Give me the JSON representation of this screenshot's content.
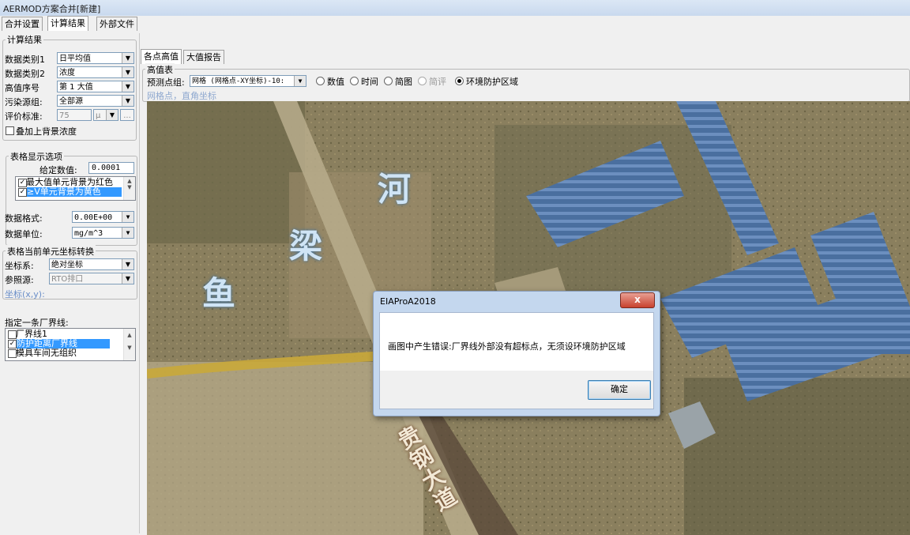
{
  "window": {
    "title": "AERMOD方案合并[新建]"
  },
  "main_tabs": [
    {
      "label": "合并设置"
    },
    {
      "label": "计算结果"
    },
    {
      "label": "外部文件"
    }
  ],
  "calc_results": {
    "group_title": "计算结果",
    "fields": [
      {
        "label": "数据类别1",
        "value": "日平均值"
      },
      {
        "label": "数据类别2",
        "value": "浓度"
      },
      {
        "label": "高值序号",
        "value": "第 1 大值"
      },
      {
        "label": "污染源组:",
        "value": "全部源"
      }
    ],
    "eval_standard": {
      "label": "评价标准:",
      "value": "75",
      "unit": "μ",
      "more": "..."
    },
    "overlay_background": {
      "label": "叠加上背景浓度",
      "checked": false
    }
  },
  "table_display": {
    "group_title": "表格显示选项",
    "given_value_label": "给定数值:",
    "given_value": "0.0001",
    "options": [
      {
        "label": "最大值单元背景为红色",
        "checked": true,
        "selected": false
      },
      {
        "label": "≥V单元背景为黄色",
        "checked": true,
        "selected": true
      }
    ],
    "data_format_label": "数据格式:",
    "data_format": "0.00E+00",
    "data_unit_label": "数据单位:",
    "data_unit": "mg/m^3"
  },
  "coord_convert": {
    "group_title": "表格当前单元坐标转换",
    "coord_system_label": "坐标系:",
    "coord_system": "绝对坐标",
    "reference_label": "参照源:",
    "reference": "RTO排口",
    "coord_readout": "坐标(x,y):"
  },
  "boundary": {
    "label": "指定一条厂界线:",
    "items": [
      {
        "label": "厂界线1",
        "checked": false,
        "selected": false
      },
      {
        "label": "防护距离厂界线",
        "checked": true,
        "selected": true
      },
      {
        "label": "模具车间无组织",
        "checked": false,
        "selected": false
      }
    ]
  },
  "result_tabs": [
    {
      "label": "各点高值"
    },
    {
      "label": "大值报告"
    }
  ],
  "high_value_table": {
    "group_title": "高值表",
    "prediction_group_label": "预测点组:",
    "prediction_group_value": "网格 (网格点-XY坐标)-10:",
    "display_modes": [
      {
        "label": "数值",
        "checked": false,
        "enabled": true
      },
      {
        "label": "时间",
        "checked": false,
        "enabled": true
      },
      {
        "label": "简图",
        "checked": false,
        "enabled": true
      },
      {
        "label": "简评",
        "checked": false,
        "enabled": false
      },
      {
        "label": "环境防护区域",
        "checked": true,
        "enabled": true
      }
    ],
    "grid_info": "网格点，直角坐标"
  },
  "map": {
    "labels": [
      "河",
      "梁",
      "鱼"
    ],
    "road_label": "贵钢大道"
  },
  "dialog": {
    "title": "EIAProA2018",
    "close_label": "x",
    "message": "画图中产生错误:厂界线外部没有超标点，无须设环境防护区域",
    "ok_label": "确定"
  }
}
